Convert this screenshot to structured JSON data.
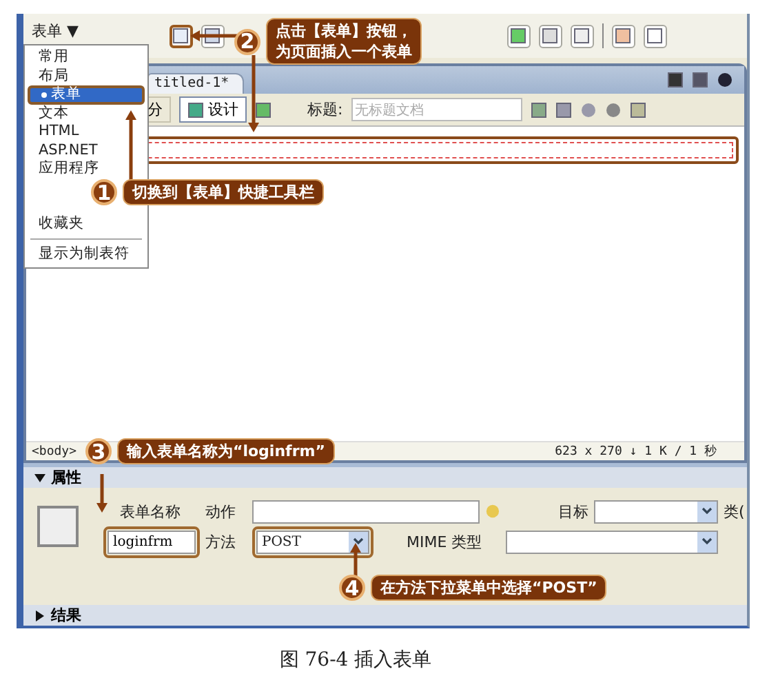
{
  "toolbar": {
    "category": "表单",
    "category_caret": "▼"
  },
  "category_menu": {
    "items": [
      {
        "label": "常用",
        "selected": false
      },
      {
        "label": "布局",
        "selected": false
      },
      {
        "label": "表单",
        "selected": true
      },
      {
        "label": "文本",
        "selected": false
      },
      {
        "label": "HTML",
        "selected": false
      },
      {
        "label": "ASP.NET",
        "selected": false
      },
      {
        "label": "应用程序",
        "selected": false
      },
      {
        "label": "收藏夹",
        "selected": false
      }
    ],
    "footer": "显示为制表符"
  },
  "document": {
    "tab": "titled-1*",
    "view_buttons": [
      {
        "label": "分",
        "selected": false
      },
      {
        "label": "设计",
        "selected": true
      }
    ],
    "title_label": "标题:",
    "title_value": "无标题文档"
  },
  "status_bar": {
    "tag": "<body>",
    "size": "623 x 270 ↓ 1 K / 1 秒"
  },
  "properties": {
    "header": "属性",
    "expanded": true,
    "form_name_label": "表单名称",
    "form_name_value": "loginfrm",
    "action_label": "动作",
    "target_label": "目标",
    "class_label": "类(",
    "method_label": "方法",
    "method_value": "POST",
    "mime_label": "MIME 类型"
  },
  "results": {
    "header": "结果",
    "expanded": false
  },
  "callouts": [
    {
      "number": "1",
      "lines": [
        "切换到【表单】快捷工具栏"
      ]
    },
    {
      "number": "2",
      "lines": [
        "点击【表单】按钮，",
        "为页面插入一个表单"
      ]
    },
    {
      "number": "3",
      "lines": [
        "输入表单名称为“loginfrm”"
      ]
    },
    {
      "number": "4",
      "lines": [
        "在方法下拉菜单中选择“POST”"
      ]
    }
  ],
  "caption": "图 76-4  插入表单"
}
